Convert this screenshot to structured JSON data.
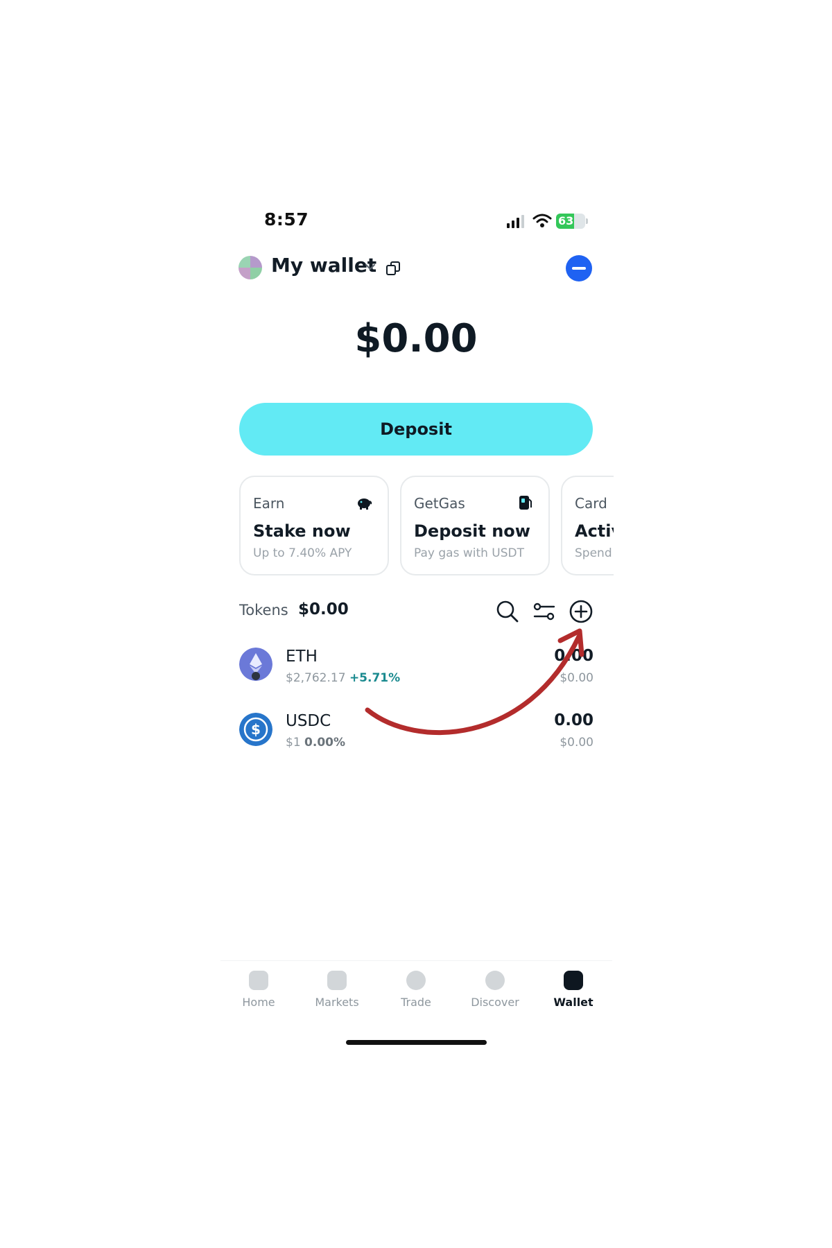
{
  "status_bar": {
    "time": "8:57",
    "battery": "63",
    "battery_level": 0.63
  },
  "header": {
    "wallet_name": "My wallet"
  },
  "balance": "$0.00",
  "deposit_label": "Deposit",
  "cards": [
    {
      "label": "Earn",
      "headline": "Stake now",
      "sub": "Up to 7.40% APY",
      "icon": "piggy-bank-icon"
    },
    {
      "label": "GetGas",
      "headline": "Deposit now",
      "sub": "Pay gas with USDT",
      "icon": "gas-pump-icon"
    },
    {
      "label": "Card",
      "headline": "Activ",
      "sub": "Spend",
      "icon": ""
    }
  ],
  "tokens": {
    "label": "Tokens",
    "total": "$0.00",
    "items": [
      {
        "symbol": "ETH",
        "price": "$2,762.17",
        "change": "+5.71%",
        "change_color": "#1a8a8f",
        "amount": "0.00",
        "value": "$0.00"
      },
      {
        "symbol": "USDC",
        "price": "$1",
        "change": "0.00%",
        "change_color": "#6b747b",
        "amount": "0.00",
        "value": "$0.00"
      }
    ]
  },
  "nav": [
    {
      "label": "Home",
      "active": false
    },
    {
      "label": "Markets",
      "active": false
    },
    {
      "label": "Trade",
      "active": false
    },
    {
      "label": "Discover",
      "active": false
    },
    {
      "label": "Wallet",
      "active": true
    }
  ],
  "colors": {
    "accent": "#62eaf4",
    "profile": "#1f62f2",
    "annotation_arrow": "#b32c2c"
  }
}
